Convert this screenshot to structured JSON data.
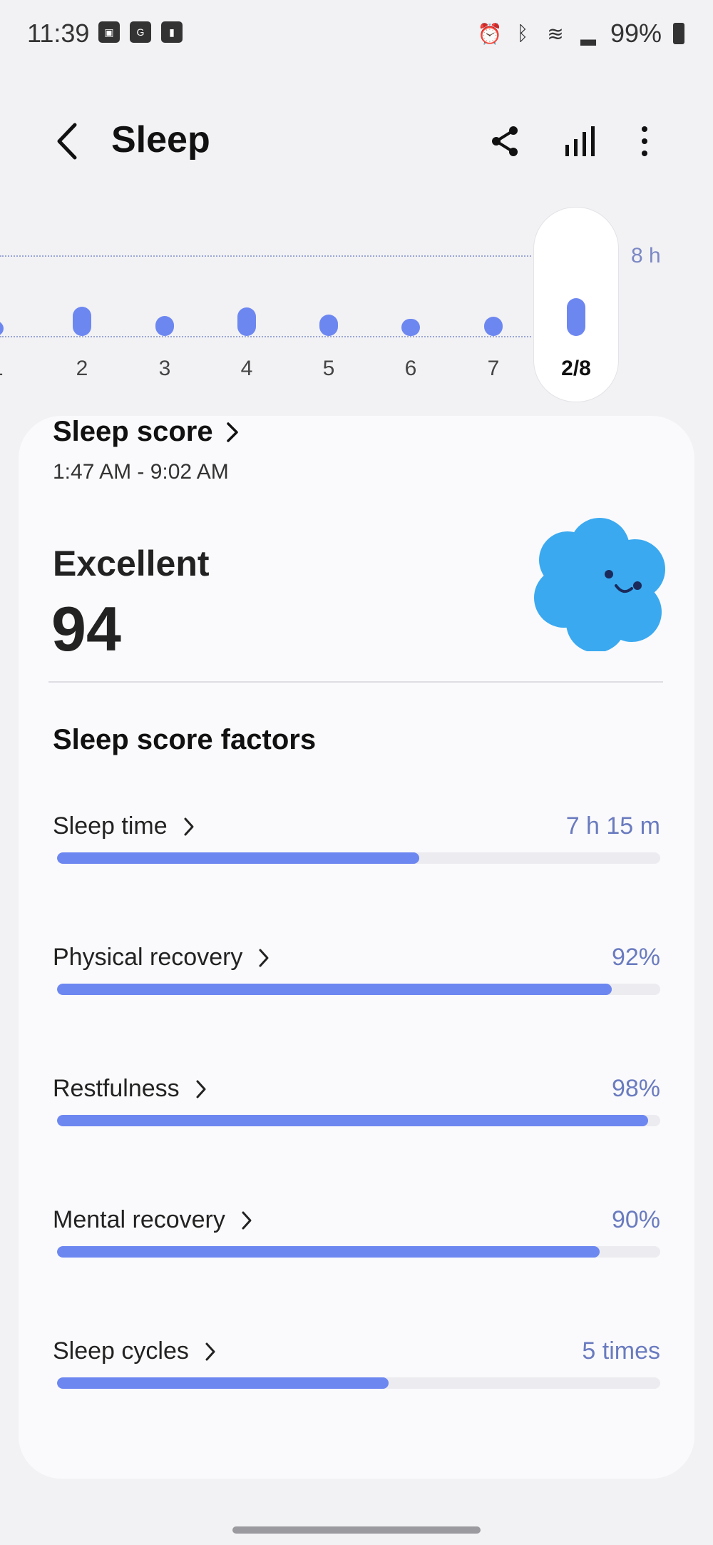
{
  "status_bar": {
    "time": "11:39",
    "battery": "99%"
  },
  "app_bar": {
    "title": "Sleep"
  },
  "chart_data": {
    "type": "bar",
    "categories": [
      "/1",
      "2",
      "3",
      "4",
      "5",
      "6",
      "7",
      "2/8"
    ],
    "values": [
      5.0,
      6.4,
      5.5,
      6.3,
      5.6,
      5.2,
      5.4,
      7.25
    ],
    "ylim": [
      0,
      8
    ],
    "target_label": "8 h",
    "selected": "2/8"
  },
  "sleep_score": {
    "title": "Sleep score",
    "time_range": "1:47 AM - 9:02 AM",
    "rating": "Excellent",
    "score": "94"
  },
  "factors": {
    "title": "Sleep score factors",
    "items": [
      {
        "label": "Sleep time",
        "value": "7 h 15 m",
        "progress": 0.6
      },
      {
        "label": "Physical recovery",
        "value": "92%",
        "progress": 0.92
      },
      {
        "label": "Restfulness",
        "value": "98%",
        "progress": 0.98
      },
      {
        "label": "Mental recovery",
        "value": "90%",
        "progress": 0.9
      },
      {
        "label": "Sleep cycles",
        "value": "5 times",
        "progress": 0.55
      }
    ]
  },
  "colors": {
    "accent": "#6d87f1",
    "value_text": "#6a7bbf"
  }
}
